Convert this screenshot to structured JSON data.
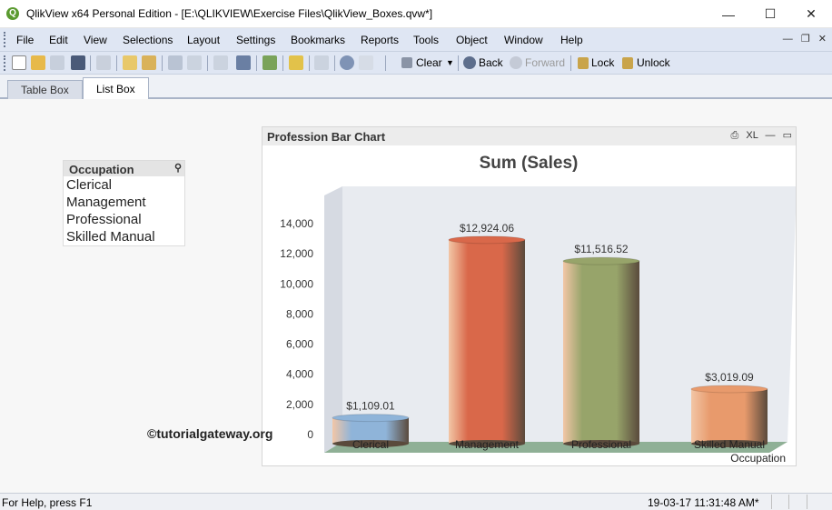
{
  "window": {
    "title": "QlikView x64 Personal Edition - [E:\\QLIKVIEW\\Exercise Files\\QlikView_Boxes.qvw*]",
    "app_icon": "Q",
    "minimize": "—",
    "maximize": "☐",
    "close": "✕"
  },
  "menu": {
    "items": [
      "File",
      "Edit",
      "View",
      "Selections",
      "Layout",
      "Settings",
      "Bookmarks",
      "Reports",
      "Tools",
      "Object",
      "Window",
      "Help"
    ],
    "mdi_minimize": "—",
    "mdi_restore": "❐",
    "mdi_close": "✕"
  },
  "toolbar": {
    "clear_label": "Clear",
    "back_label": "Back",
    "forward_label": "Forward",
    "lock_label": "Lock",
    "unlock_label": "Unlock"
  },
  "tabs": [
    {
      "label": "Table Box"
    },
    {
      "label": "List Box"
    }
  ],
  "listbox": {
    "title": "Occupation",
    "search_icon": "⚲",
    "items": [
      "Clerical",
      "Management",
      "Professional",
      "Skilled Manual"
    ]
  },
  "chartbox": {
    "caption": "Profession Bar Chart",
    "print_icon": "⎙",
    "xl_label": "XL",
    "min_icon": "—",
    "max_icon": "▭"
  },
  "chart_data": {
    "type": "bar",
    "title": "Sum (Sales)",
    "xlabel": "Occupation",
    "ylabel": "",
    "categories": [
      "Clerical",
      "Management",
      "Professional",
      "Skilled Manual"
    ],
    "values": [
      1109.01,
      12924.06,
      11516.52,
      3019.09
    ],
    "value_labels": [
      "$1,109.01",
      "$12,924.06",
      "$11,516.52",
      "$3,019.09"
    ],
    "yticks": [
      "0",
      "2,000",
      "4,000",
      "6,000",
      "8,000",
      "10,000",
      "12,000",
      "14,000"
    ],
    "ylim": [
      0,
      15000
    ],
    "colors": [
      "#8fb4d9",
      "#d9684a",
      "#97a46a",
      "#e89a6c"
    ],
    "dark_color": "#5a4a3c",
    "floor_color": "#8fb096"
  },
  "watermark": "©tutorialgateway.org",
  "status": {
    "left": "For Help, press F1",
    "right": "19-03-17 11:31:48 AM*"
  }
}
